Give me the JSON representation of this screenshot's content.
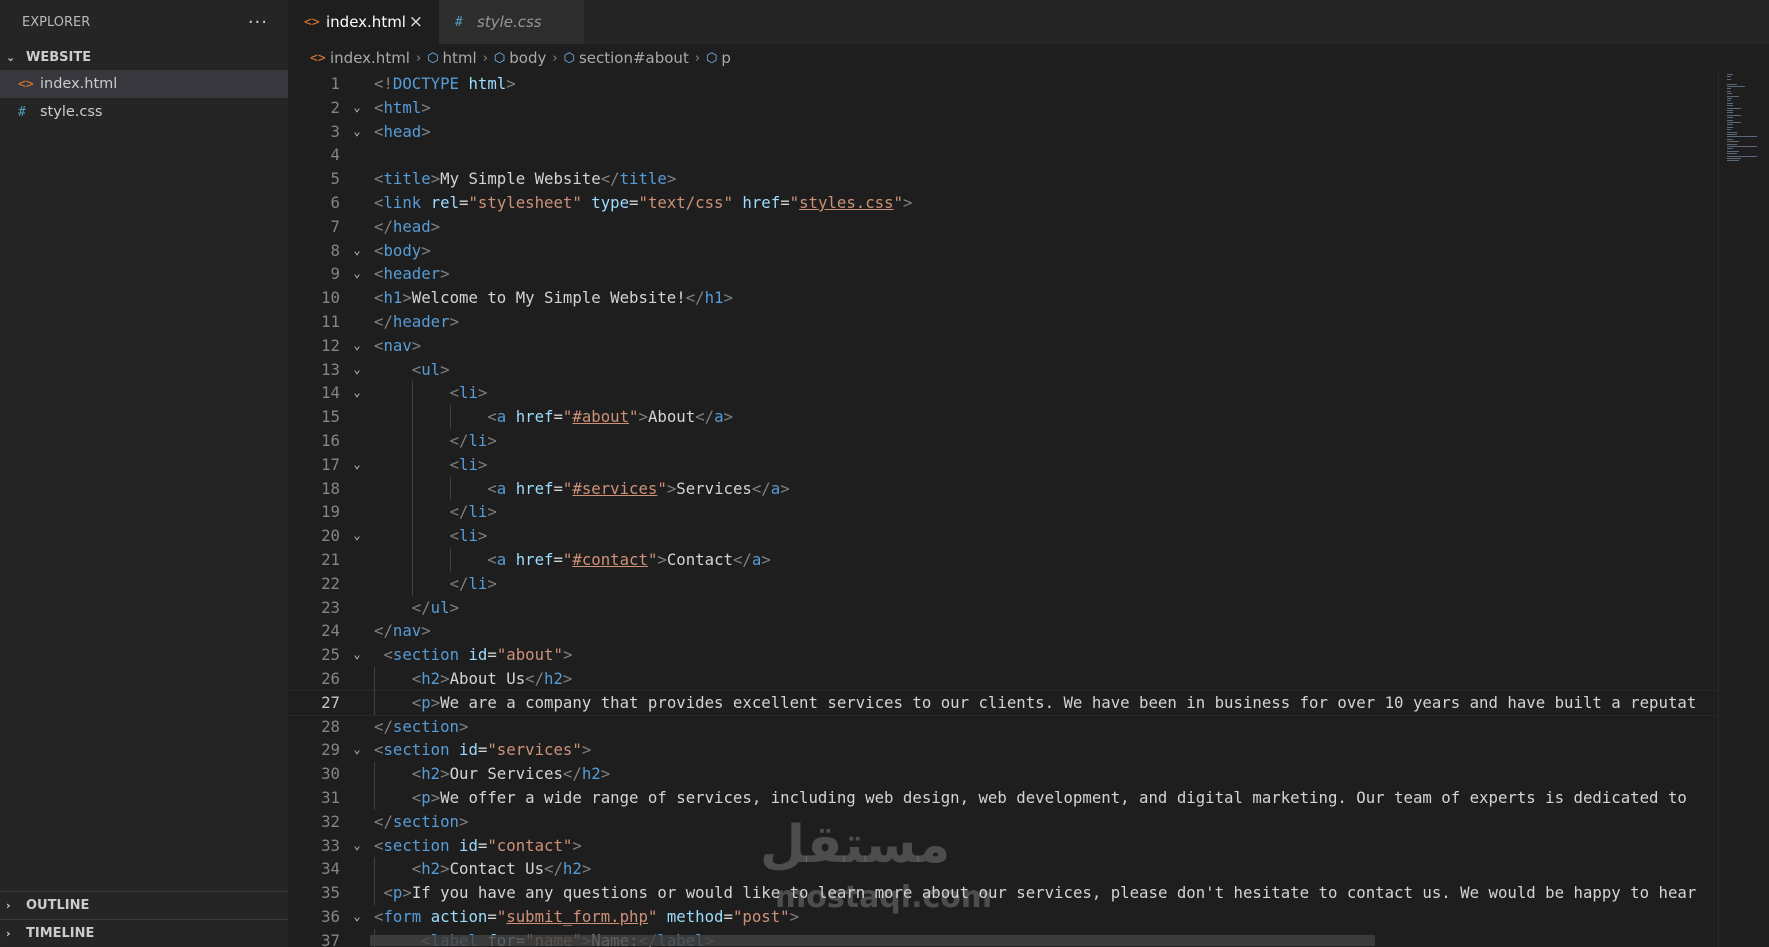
{
  "explorer": {
    "title": "EXPLORER",
    "more_icon": "ellipsis-icon",
    "folder": "WEBSITE",
    "files": [
      {
        "name": "index.html",
        "icon": "html-file-icon",
        "active": true
      },
      {
        "name": "style.css",
        "icon": "css-file-icon",
        "active": false
      }
    ],
    "outline": "OUTLINE",
    "timeline": "TIMELINE"
  },
  "tabs": [
    {
      "label": "index.html",
      "icon": "html-file-icon",
      "active": true,
      "close": "×"
    },
    {
      "label": "style.css",
      "icon": "css-file-icon",
      "active": false
    }
  ],
  "breadcrumb": [
    "index.html",
    "html",
    "body",
    "section#about",
    "p"
  ],
  "editor": {
    "current_line": 27,
    "lines": [
      {
        "n": "1",
        "fold": "",
        "tokens": [
          [
            "b",
            "<!"
          ],
          [
            "kw",
            "DOCTYPE "
          ],
          [
            "attr",
            "html"
          ],
          [
            "b",
            ">"
          ]
        ]
      },
      {
        "n": "2",
        "fold": "⌄",
        "tokens": [
          [
            "b",
            "<"
          ],
          [
            "tag",
            "html"
          ],
          [
            "b",
            ">"
          ]
        ]
      },
      {
        "n": "3",
        "fold": "⌄",
        "tokens": [
          [
            "b",
            "<"
          ],
          [
            "tag",
            "head"
          ],
          [
            "b",
            ">"
          ]
        ]
      },
      {
        "n": "4",
        "fold": "",
        "tokens": []
      },
      {
        "n": "5",
        "fold": "",
        "tokens": [
          [
            "b",
            "<"
          ],
          [
            "tag",
            "title"
          ],
          [
            "b",
            ">"
          ],
          [
            "txt",
            "My Simple Website"
          ],
          [
            "b",
            "</"
          ],
          [
            "tag",
            "title"
          ],
          [
            "b",
            ">"
          ]
        ]
      },
      {
        "n": "6",
        "fold": "",
        "tokens": [
          [
            "b",
            "<"
          ],
          [
            "tag",
            "link "
          ],
          [
            "attr",
            "rel"
          ],
          [
            "txt",
            "="
          ],
          [
            "str",
            "\"stylesheet\" "
          ],
          [
            "attr",
            "type"
          ],
          [
            "txt",
            "="
          ],
          [
            "str",
            "\"text/css\" "
          ],
          [
            "attr",
            "href"
          ],
          [
            "txt",
            "="
          ],
          [
            "str",
            "\""
          ],
          [
            "link",
            "styles.css"
          ],
          [
            "str",
            "\""
          ],
          [
            "b",
            ">"
          ]
        ]
      },
      {
        "n": "7",
        "fold": "",
        "tokens": [
          [
            "b",
            "</"
          ],
          [
            "tag",
            "head"
          ],
          [
            "b",
            ">"
          ]
        ]
      },
      {
        "n": "8",
        "fold": "⌄",
        "tokens": [
          [
            "b",
            "<"
          ],
          [
            "tag",
            "body"
          ],
          [
            "b",
            ">"
          ]
        ]
      },
      {
        "n": "9",
        "fold": "⌄",
        "tokens": [
          [
            "b",
            "<"
          ],
          [
            "tag",
            "header"
          ],
          [
            "b",
            ">"
          ]
        ]
      },
      {
        "n": "10",
        "fold": "",
        "tokens": [
          [
            "b",
            "<"
          ],
          [
            "tag",
            "h1"
          ],
          [
            "b",
            ">"
          ],
          [
            "txt",
            "Welcome to My Simple Website!"
          ],
          [
            "b",
            "</"
          ],
          [
            "tag",
            "h1"
          ],
          [
            "b",
            ">"
          ]
        ]
      },
      {
        "n": "11",
        "fold": "",
        "tokens": [
          [
            "b",
            "</"
          ],
          [
            "tag",
            "header"
          ],
          [
            "b",
            ">"
          ]
        ]
      },
      {
        "n": "12",
        "fold": "⌄",
        "tokens": [
          [
            "b",
            "<"
          ],
          [
            "tag",
            "nav"
          ],
          [
            "b",
            ">"
          ]
        ]
      },
      {
        "n": "13",
        "fold": "⌄",
        "tokens": [
          [
            "txt",
            "    "
          ],
          [
            "b",
            "<"
          ],
          [
            "tag",
            "ul"
          ],
          [
            "b",
            ">"
          ]
        ]
      },
      {
        "n": "14",
        "fold": "⌄",
        "tokens": [
          [
            "txt",
            "        "
          ],
          [
            "b",
            "<"
          ],
          [
            "tag",
            "li"
          ],
          [
            "b",
            ">"
          ]
        ]
      },
      {
        "n": "15",
        "fold": "",
        "tokens": [
          [
            "txt",
            "            "
          ],
          [
            "b",
            "<"
          ],
          [
            "tag",
            "a "
          ],
          [
            "attr",
            "href"
          ],
          [
            "txt",
            "="
          ],
          [
            "str",
            "\""
          ],
          [
            "link",
            "#about"
          ],
          [
            "str",
            "\""
          ],
          [
            "b",
            ">"
          ],
          [
            "txt",
            "About"
          ],
          [
            "b",
            "</"
          ],
          [
            "tag",
            "a"
          ],
          [
            "b",
            ">"
          ]
        ]
      },
      {
        "n": "16",
        "fold": "",
        "tokens": [
          [
            "txt",
            "        "
          ],
          [
            "b",
            "</"
          ],
          [
            "tag",
            "li"
          ],
          [
            "b",
            ">"
          ]
        ]
      },
      {
        "n": "17",
        "fold": "⌄",
        "tokens": [
          [
            "txt",
            "        "
          ],
          [
            "b",
            "<"
          ],
          [
            "tag",
            "li"
          ],
          [
            "b",
            ">"
          ]
        ]
      },
      {
        "n": "18",
        "fold": "",
        "tokens": [
          [
            "txt",
            "            "
          ],
          [
            "b",
            "<"
          ],
          [
            "tag",
            "a "
          ],
          [
            "attr",
            "href"
          ],
          [
            "txt",
            "="
          ],
          [
            "str",
            "\""
          ],
          [
            "link",
            "#services"
          ],
          [
            "str",
            "\""
          ],
          [
            "b",
            ">"
          ],
          [
            "txt",
            "Services"
          ],
          [
            "b",
            "</"
          ],
          [
            "tag",
            "a"
          ],
          [
            "b",
            ">"
          ]
        ]
      },
      {
        "n": "19",
        "fold": "",
        "tokens": [
          [
            "txt",
            "        "
          ],
          [
            "b",
            "</"
          ],
          [
            "tag",
            "li"
          ],
          [
            "b",
            ">"
          ]
        ]
      },
      {
        "n": "20",
        "fold": "⌄",
        "tokens": [
          [
            "txt",
            "        "
          ],
          [
            "b",
            "<"
          ],
          [
            "tag",
            "li"
          ],
          [
            "b",
            ">"
          ]
        ]
      },
      {
        "n": "21",
        "fold": "",
        "tokens": [
          [
            "txt",
            "            "
          ],
          [
            "b",
            "<"
          ],
          [
            "tag",
            "a "
          ],
          [
            "attr",
            "href"
          ],
          [
            "txt",
            "="
          ],
          [
            "str",
            "\""
          ],
          [
            "link",
            "#contact"
          ],
          [
            "str",
            "\""
          ],
          [
            "b",
            ">"
          ],
          [
            "txt",
            "Contact"
          ],
          [
            "b",
            "</"
          ],
          [
            "tag",
            "a"
          ],
          [
            "b",
            ">"
          ]
        ]
      },
      {
        "n": "22",
        "fold": "",
        "tokens": [
          [
            "txt",
            "        "
          ],
          [
            "b",
            "</"
          ],
          [
            "tag",
            "li"
          ],
          [
            "b",
            ">"
          ]
        ]
      },
      {
        "n": "23",
        "fold": "",
        "tokens": [
          [
            "txt",
            "    "
          ],
          [
            "b",
            "</"
          ],
          [
            "tag",
            "ul"
          ],
          [
            "b",
            ">"
          ]
        ]
      },
      {
        "n": "24",
        "fold": "",
        "tokens": [
          [
            "b",
            "</"
          ],
          [
            "tag",
            "nav"
          ],
          [
            "b",
            ">"
          ]
        ]
      },
      {
        "n": "25",
        "fold": "⌄",
        "tokens": [
          [
            "txt",
            " "
          ],
          [
            "b",
            "<"
          ],
          [
            "tag",
            "section "
          ],
          [
            "attr",
            "id"
          ],
          [
            "txt",
            "="
          ],
          [
            "str",
            "\"about\""
          ],
          [
            "b",
            ">"
          ]
        ]
      },
      {
        "n": "26",
        "fold": "",
        "tokens": [
          [
            "txt",
            "    "
          ],
          [
            "b",
            "<"
          ],
          [
            "tag",
            "h2"
          ],
          [
            "b",
            ">"
          ],
          [
            "txt",
            "About Us"
          ],
          [
            "b",
            "</"
          ],
          [
            "tag",
            "h2"
          ],
          [
            "b",
            ">"
          ]
        ]
      },
      {
        "n": "27",
        "fold": "",
        "tokens": [
          [
            "txt",
            "    "
          ],
          [
            "b",
            "<"
          ],
          [
            "tag",
            "p"
          ],
          [
            "b",
            ">"
          ],
          [
            "txt",
            "We are a company that provides excellent services to our clients. We have been in business for over 10 years and have built a reputat"
          ]
        ]
      },
      {
        "n": "28",
        "fold": "",
        "tokens": [
          [
            "b",
            "</"
          ],
          [
            "tag",
            "section"
          ],
          [
            "b",
            ">"
          ]
        ]
      },
      {
        "n": "29",
        "fold": "⌄",
        "tokens": [
          [
            "b",
            "<"
          ],
          [
            "tag",
            "section "
          ],
          [
            "attr",
            "id"
          ],
          [
            "txt",
            "="
          ],
          [
            "str",
            "\"services\""
          ],
          [
            "b",
            ">"
          ]
        ]
      },
      {
        "n": "30",
        "fold": "",
        "tokens": [
          [
            "txt",
            "    "
          ],
          [
            "b",
            "<"
          ],
          [
            "tag",
            "h2"
          ],
          [
            "b",
            ">"
          ],
          [
            "txt",
            "Our Services"
          ],
          [
            "b",
            "</"
          ],
          [
            "tag",
            "h2"
          ],
          [
            "b",
            ">"
          ]
        ]
      },
      {
        "n": "31",
        "fold": "",
        "tokens": [
          [
            "txt",
            "    "
          ],
          [
            "b",
            "<"
          ],
          [
            "tag",
            "p"
          ],
          [
            "b",
            ">"
          ],
          [
            "txt",
            "We offer a wide range of services, including web design, web development, and digital marketing. Our team of experts is dedicated to "
          ]
        ]
      },
      {
        "n": "32",
        "fold": "",
        "tokens": [
          [
            "b",
            "</"
          ],
          [
            "tag",
            "section"
          ],
          [
            "b",
            ">"
          ]
        ]
      },
      {
        "n": "33",
        "fold": "⌄",
        "tokens": [
          [
            "b",
            "<"
          ],
          [
            "tag",
            "section "
          ],
          [
            "attr",
            "id"
          ],
          [
            "txt",
            "="
          ],
          [
            "str",
            "\"contact\""
          ],
          [
            "b",
            ">"
          ]
        ]
      },
      {
        "n": "34",
        "fold": "",
        "tokens": [
          [
            "txt",
            "    "
          ],
          [
            "b",
            "<"
          ],
          [
            "tag",
            "h2"
          ],
          [
            "b",
            ">"
          ],
          [
            "txt",
            "Contact Us"
          ],
          [
            "b",
            "</"
          ],
          [
            "tag",
            "h2"
          ],
          [
            "b",
            ">"
          ]
        ]
      },
      {
        "n": "35",
        "fold": "",
        "tokens": [
          [
            "txt",
            " "
          ],
          [
            "b",
            "<"
          ],
          [
            "tag",
            "p"
          ],
          [
            "b",
            ">"
          ],
          [
            "txt",
            "If you have any questions or would like to learn more about our services, please don't hesitate to contact us. We would be happy to hear"
          ]
        ]
      },
      {
        "n": "36",
        "fold": "⌄",
        "tokens": [
          [
            "b",
            "<"
          ],
          [
            "tag",
            "form "
          ],
          [
            "attr",
            "action"
          ],
          [
            "txt",
            "="
          ],
          [
            "str",
            "\""
          ],
          [
            "link",
            "submit_form.php"
          ],
          [
            "str",
            "\" "
          ],
          [
            "attr",
            "method"
          ],
          [
            "txt",
            "="
          ],
          [
            "str",
            "\"post\""
          ],
          [
            "b",
            ">"
          ]
        ]
      },
      {
        "n": "37",
        "fold": "",
        "tokens": [
          [
            "txt",
            "     "
          ],
          [
            "b",
            "<"
          ],
          [
            "tag",
            "label "
          ],
          [
            "attr",
            "for"
          ],
          [
            "txt",
            "="
          ],
          [
            "str",
            "\"name\""
          ],
          [
            "b",
            ">"
          ],
          [
            "txt",
            "Name:"
          ],
          [
            "b",
            "</"
          ],
          [
            "tag",
            "label"
          ],
          [
            "b",
            ">"
          ]
        ]
      }
    ]
  },
  "watermark": {
    "arabic": "مستقل",
    "latin": "mostaql.com"
  }
}
